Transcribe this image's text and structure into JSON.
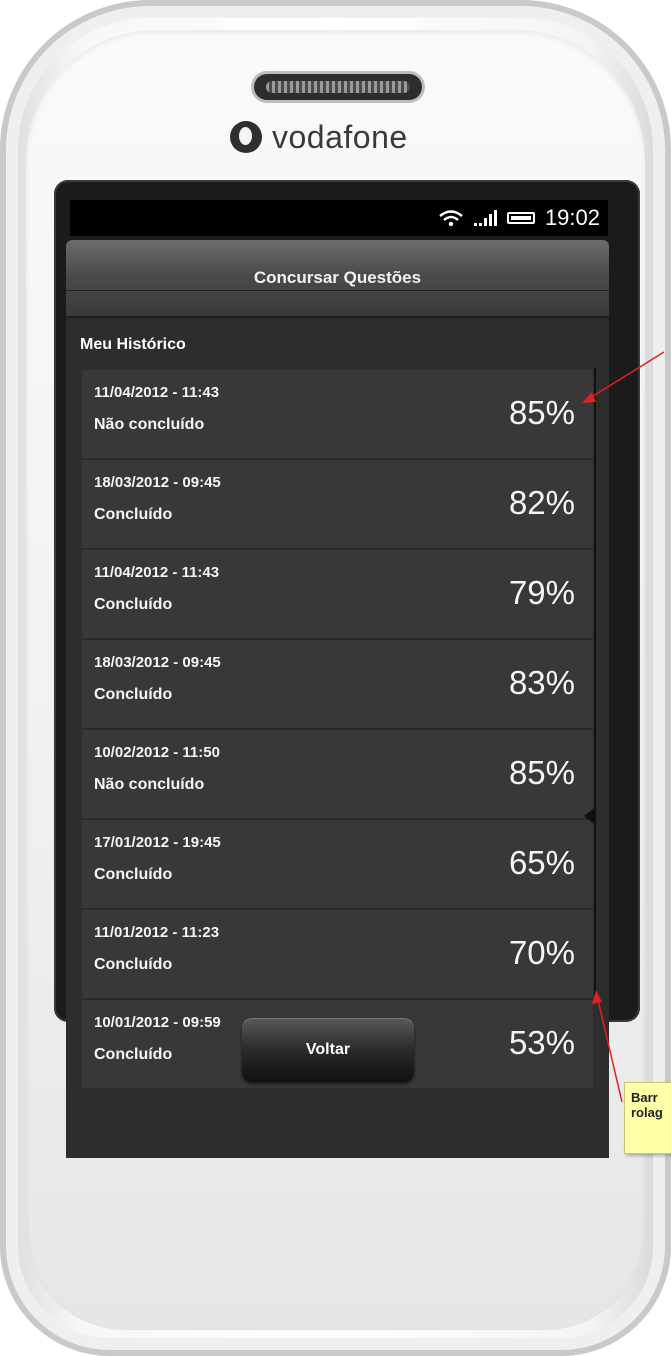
{
  "device": {
    "brand": "vodafone",
    "status_bar": {
      "time": "19:02"
    }
  },
  "app": {
    "title": "Concursar Questões",
    "section_heading": "Meu Histórico",
    "history": [
      {
        "date": "11/04/2012 - 11:43",
        "status": "Não concluído",
        "percent": "85%"
      },
      {
        "date": "18/03/2012 - 09:45",
        "status": "Concluído",
        "percent": "82%"
      },
      {
        "date": "11/04/2012 - 11:43",
        "status": "Concluído",
        "percent": "79%"
      },
      {
        "date": "18/03/2012 - 09:45",
        "status": "Concluído",
        "percent": "83%"
      },
      {
        "date": "10/02/2012 - 11:50",
        "status": "Não concluído",
        "percent": "85%"
      },
      {
        "date": "17/01/2012 - 19:45",
        "status": "Concluído",
        "percent": "65%"
      },
      {
        "date": "11/01/2012 - 11:23",
        "status": "Concluído",
        "percent": "70%"
      },
      {
        "date": "10/01/2012 - 09:59",
        "status": "Concluído",
        "percent": "53%"
      }
    ],
    "back_button_label": "Voltar"
  },
  "annotation": {
    "note_line1": "Barr",
    "note_line2": "rolag"
  },
  "colors": {
    "app_background": "#2d2d2d",
    "row_background": "#383838",
    "annotation_arrow": "#e02020",
    "note_background": "#ffffa8"
  }
}
